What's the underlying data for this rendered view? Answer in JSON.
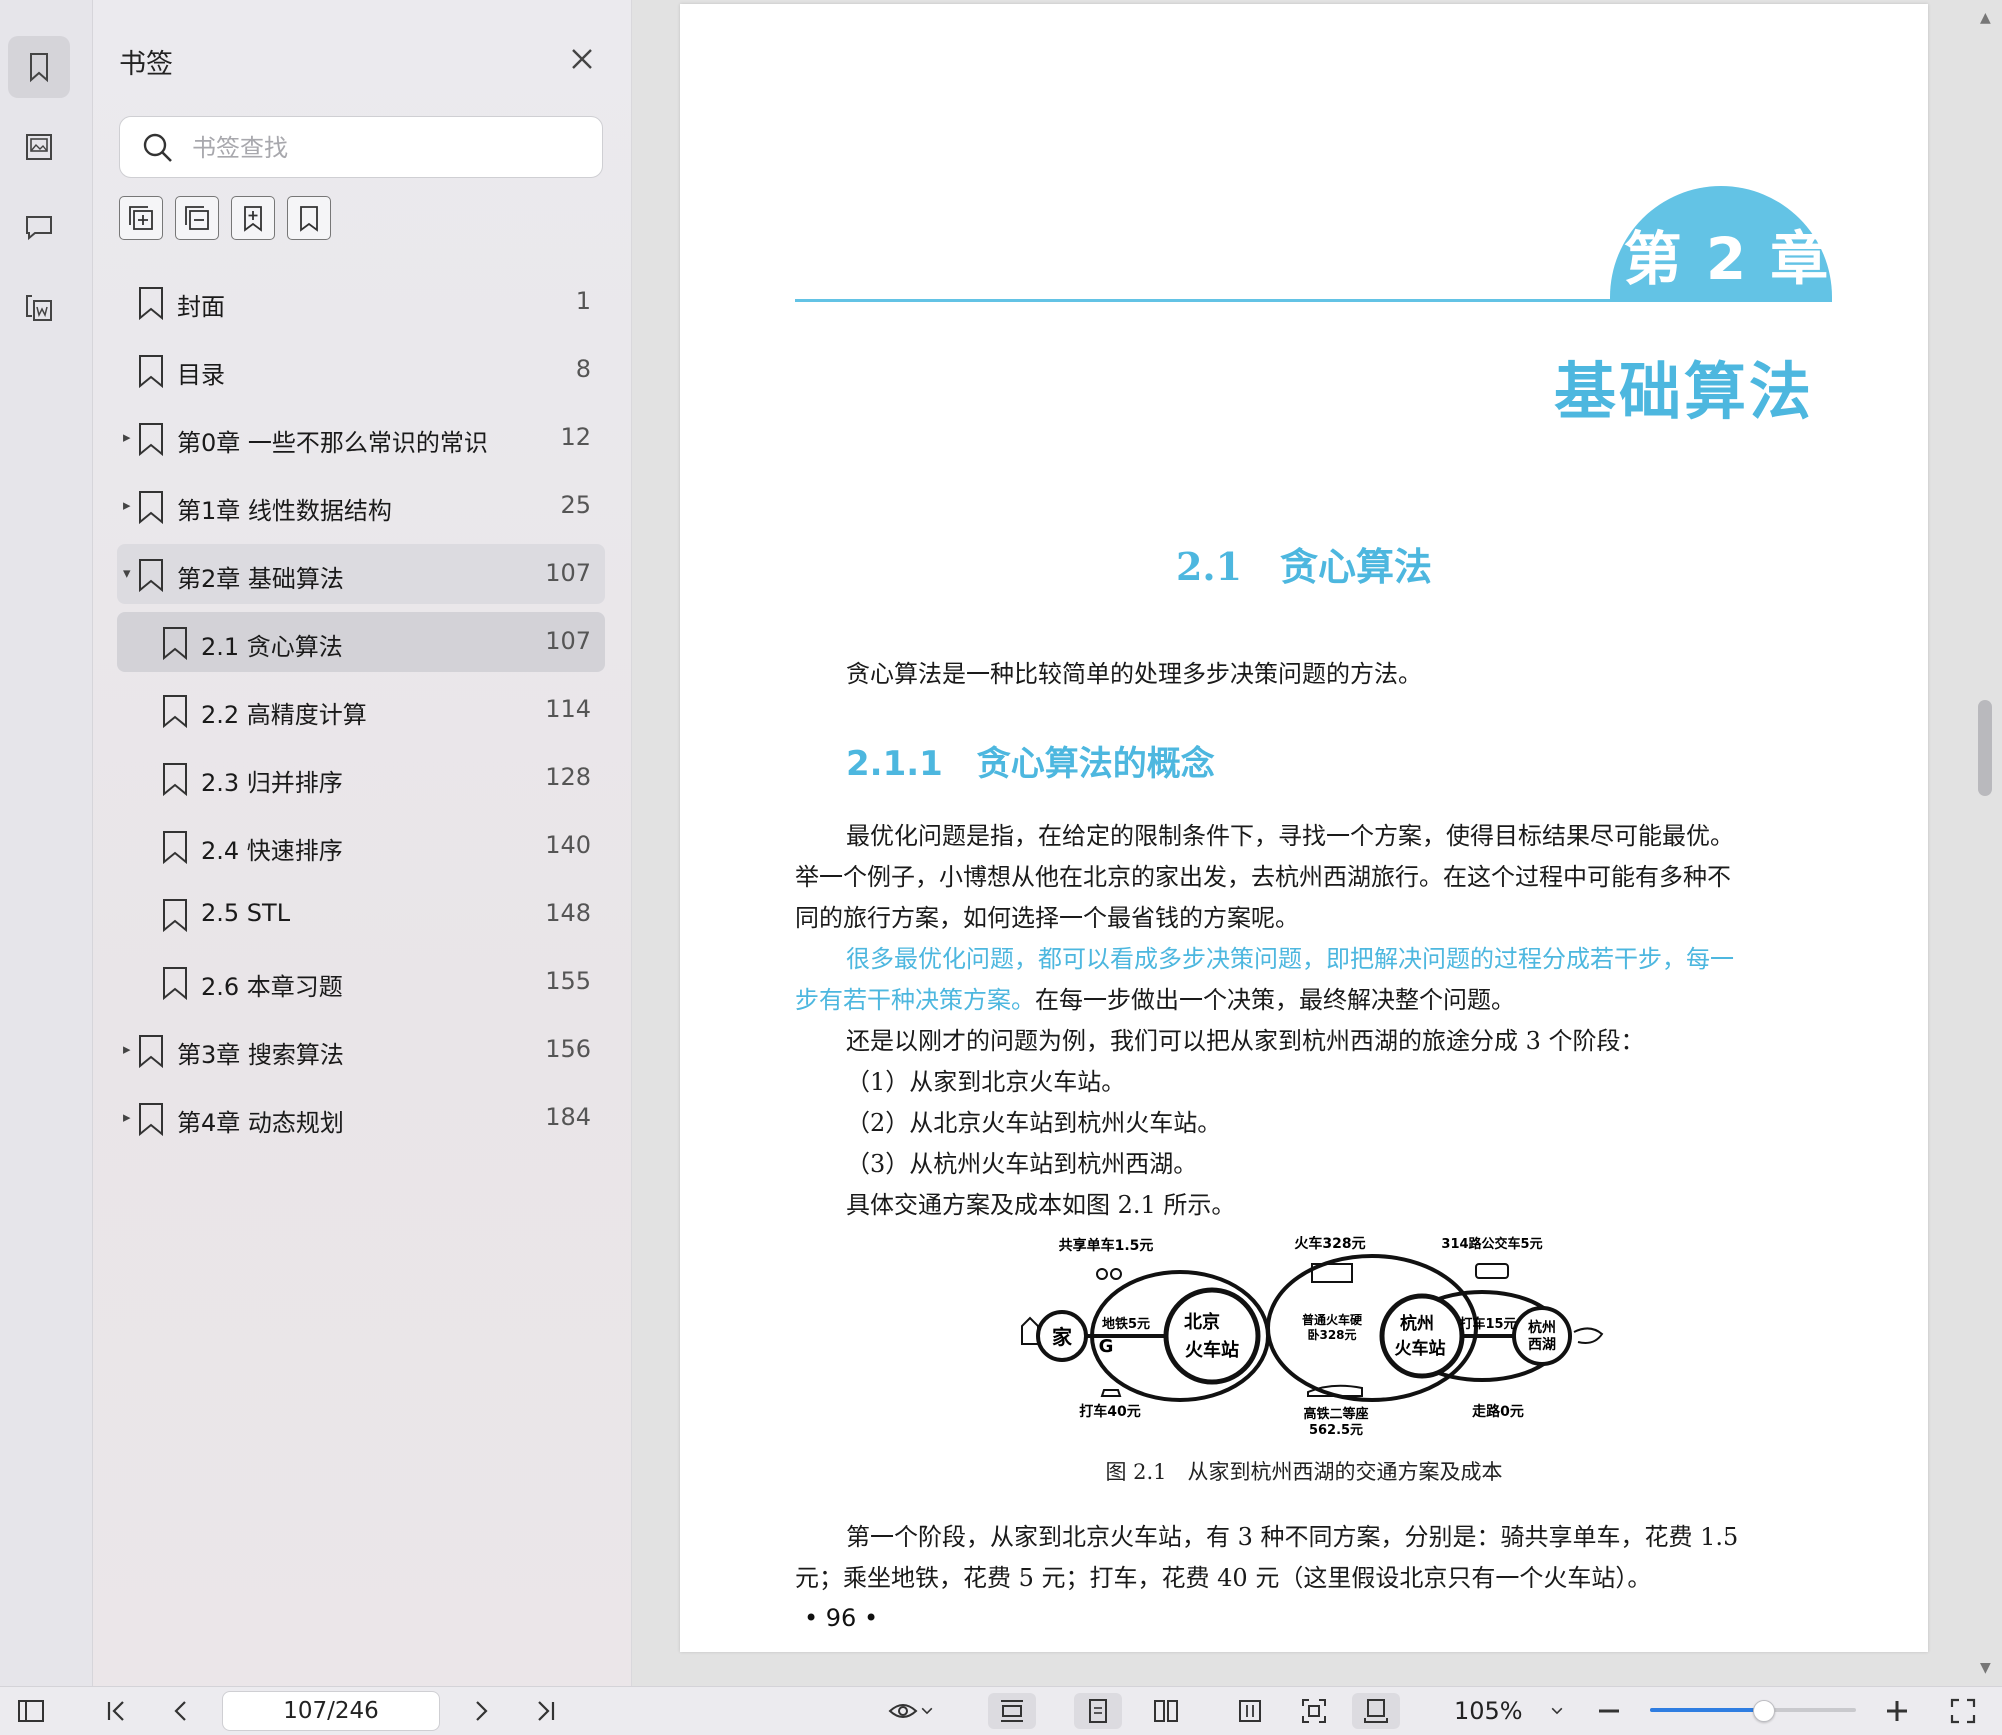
{
  "rail": {
    "icons": [
      "bookmark-icon",
      "thumbnail-icon",
      "comment-icon",
      "attachment-icon"
    ]
  },
  "sidebar": {
    "title": "书签",
    "search_placeholder": "书签查找",
    "tools": [
      "expand-all-icon",
      "collapse-all-icon",
      "add-bookmark-icon",
      "bookmark-outline-icon"
    ],
    "bookmarks": [
      {
        "label": "封面",
        "page": "1",
        "level": 0,
        "caret": ""
      },
      {
        "label": "目录",
        "page": "8",
        "level": 0,
        "caret": ""
      },
      {
        "label": "第0章 一些不那么常识的常识",
        "page": "12",
        "level": 0,
        "caret": "▸"
      },
      {
        "label": "第1章 线性数据结构",
        "page": "25",
        "level": 0,
        "caret": "▸"
      },
      {
        "label": "第2章 基础算法",
        "page": "107",
        "level": 0,
        "caret": "▾"
      },
      {
        "label": "2.1 贪心算法",
        "page": "107",
        "level": 1,
        "caret": ""
      },
      {
        "label": "2.2 高精度计算",
        "page": "114",
        "level": 1,
        "caret": ""
      },
      {
        "label": "2.3 归并排序",
        "page": "128",
        "level": 1,
        "caret": ""
      },
      {
        "label": "2.4 快速排序",
        "page": "140",
        "level": 1,
        "caret": ""
      },
      {
        "label": "2.5 STL",
        "page": "148",
        "level": 1,
        "caret": ""
      },
      {
        "label": "2.6 本章习题",
        "page": "155",
        "level": 1,
        "caret": ""
      },
      {
        "label": "第3章 搜索算法",
        "page": "156",
        "level": 0,
        "caret": "▸"
      },
      {
        "label": "第4章 动态规划",
        "page": "184",
        "level": 0,
        "caret": "▸"
      }
    ]
  },
  "doc": {
    "chapter_num": "第 2 章",
    "chapter_title": "基础算法",
    "section_title": "2.1　贪心算法",
    "intro": "贪心算法是一种比较简单的处理多步决策问题的方法。",
    "subsection_title": "2.1.1　贪心算法的概念",
    "p1_l1": "最优化问题是指，在给定的限制条件下，寻找一个方案，使得目标结果尽可能最优。",
    "p1_l2": "举一个例子，小博想从他在北京的家出发，去杭州西湖旅行。在这个过程中可能有多种不",
    "p1_l3": "同的旅行方案，如何选择一个最省钱的方案呢。",
    "p2_l1": "很多最优化问题，都可以看成多步决策问题，即把解决问题的过程分成若干步，每一",
    "p2_l2_hl": "步有若干种决策方案。",
    "p2_l2_rest": "在每一步做出一个决策，最终解决整个问题。",
    "p3": "还是以刚才的问题为例，我们可以把从家到杭州西湖的旅途分成 3 个阶段：",
    "step1": "（1）从家到北京火车站。",
    "step2": "（2）从北京火车站到杭州火车站。",
    "step3": "（3）从杭州火车站到杭州西湖。",
    "p4": "具体交通方案及成本如图 2.1 所示。",
    "figure": {
      "bike": "共享单车1.5元",
      "train": "火车328元",
      "bus": "314路公交车5元",
      "home": "家",
      "subway": "地铁5元",
      "bj_station": "北京火车站",
      "regular_train": "普通火车硬卧328元",
      "hz_station": "杭州火车站",
      "taxi15": "打车15元",
      "westlake": "杭州西湖",
      "taxi40": "打车40元",
      "hsr": "高铁二等座562.5元",
      "walk": "走路0元"
    },
    "fig_caption": "图 2.1　从家到杭州西湖的交通方案及成本",
    "p5_l1": "第一个阶段，从家到北京火车站，有 3 种不同方案，分别是：骑共享单车，花费 1.5",
    "p5_l2": "元；乘坐地铁，花费 5 元；打车，花费 40 元（这里假设北京只有一个火车站）。",
    "page_number": "• 96 •"
  },
  "statusbar": {
    "page_indicator": "107/246",
    "zoom": "105%",
    "zoom_slider_fraction": 0.55
  },
  "colors": {
    "accent": "#4db7df",
    "slider": "#2f7de1"
  }
}
